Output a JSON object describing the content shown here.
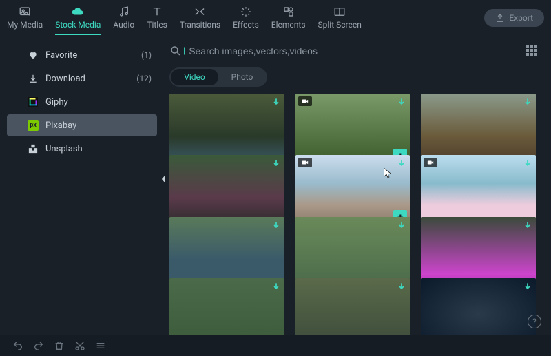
{
  "topTabs": [
    {
      "label": "My Media",
      "name": "tab-my-media"
    },
    {
      "label": "Stock Media",
      "name": "tab-stock-media",
      "active": true
    },
    {
      "label": "Audio",
      "name": "tab-audio"
    },
    {
      "label": "Titles",
      "name": "tab-titles"
    },
    {
      "label": "Transitions",
      "name": "tab-transitions"
    },
    {
      "label": "Effects",
      "name": "tab-effects"
    },
    {
      "label": "Elements",
      "name": "tab-elements"
    },
    {
      "label": "Split Screen",
      "name": "tab-split-screen"
    }
  ],
  "exportLabel": "Export",
  "sidebar": [
    {
      "label": "Favorite",
      "count": "(1)",
      "icon": "heart-icon",
      "name": "sidebar-item-favorite"
    },
    {
      "label": "Download",
      "count": "(12)",
      "icon": "download-icon",
      "name": "sidebar-item-download"
    },
    {
      "label": "Giphy",
      "count": "",
      "icon": "giphy-icon",
      "name": "sidebar-item-giphy"
    },
    {
      "label": "Pixabay",
      "count": "",
      "icon": "pixabay-icon",
      "name": "sidebar-item-pixabay",
      "selected": true
    },
    {
      "label": "Unsplash",
      "count": "",
      "icon": "unsplash-icon",
      "name": "sidebar-item-unsplash"
    }
  ],
  "search": {
    "placeholder": "Search images,vectors,videos",
    "value": ""
  },
  "mediaToggle": {
    "options": [
      {
        "label": "Video",
        "active": true
      },
      {
        "label": "Photo",
        "active": false
      }
    ]
  },
  "thumbs": [
    {
      "g": "g1",
      "name": "thumb-1"
    },
    {
      "g": "g2",
      "name": "thumb-2",
      "showAdd": true,
      "showCam": true
    },
    {
      "g": "g3",
      "name": "thumb-3"
    },
    {
      "g": "g4",
      "name": "thumb-4"
    },
    {
      "g": "g5",
      "name": "thumb-5",
      "showAdd": true,
      "showCam": true,
      "hovered": true
    },
    {
      "g": "g6",
      "name": "thumb-6",
      "showVidBadge": true
    },
    {
      "g": "g7",
      "name": "thumb-7"
    },
    {
      "g": "g8",
      "name": "thumb-8"
    },
    {
      "g": "g9",
      "name": "thumb-9"
    },
    {
      "g": "g10",
      "name": "thumb-10"
    },
    {
      "g": "g11",
      "name": "thumb-11"
    },
    {
      "g": "g12",
      "name": "thumb-12"
    }
  ],
  "icons": {
    "add": "+",
    "help": "?"
  }
}
